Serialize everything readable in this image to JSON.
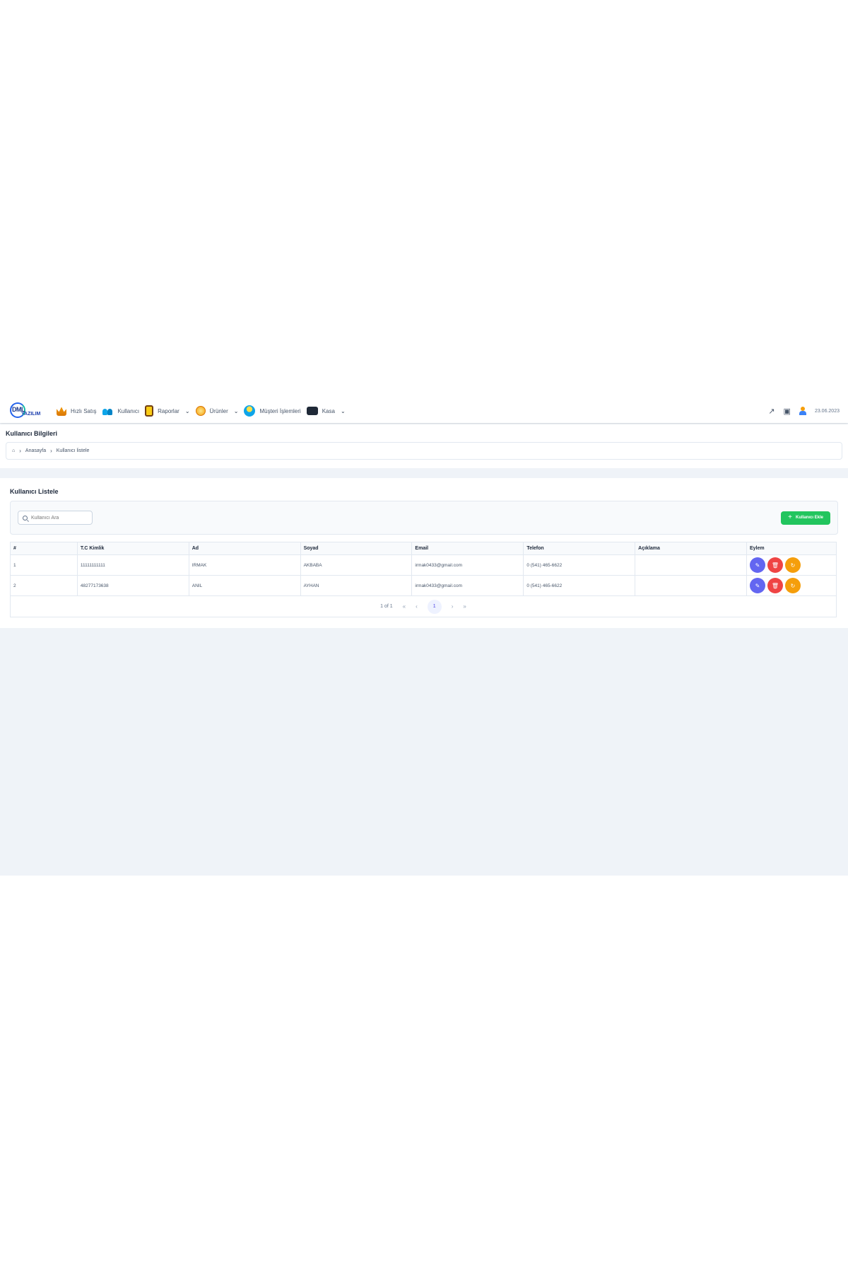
{
  "app": {
    "logo_text": "DML",
    "logo_sub": "YAZILIM"
  },
  "nav": [
    {
      "icon": "crown-icon",
      "label": "Hızlı Satış",
      "has_menu": false
    },
    {
      "icon": "users-icon",
      "label": "Kullanıcı",
      "has_menu": false
    },
    {
      "icon": "report-icon",
      "label": "Raporlar",
      "has_menu": true
    },
    {
      "icon": "coin-icon",
      "label": "Ürünler",
      "has_menu": true
    },
    {
      "icon": "customer-icon",
      "label": "Müşteri İşlemleri",
      "has_menu": false
    },
    {
      "icon": "cash-register-icon",
      "label": "Kasa",
      "has_menu": true
    }
  ],
  "header": {
    "date": "23.06.2023"
  },
  "info": {
    "title": "Kullanıcı Bilgileri",
    "breadcrumb": [
      "Anasayfa",
      "Kullanıcı listele"
    ]
  },
  "list": {
    "title": "Kullanıcı Listele",
    "search_placeholder": "Kullanıcı Ara",
    "add_button": "Kullanıcı Ekle",
    "columns": [
      "#",
      "T.C Kimlik",
      "Ad",
      "Soyad",
      "Email",
      "Telefon",
      "Açıklama",
      "Eylem"
    ],
    "rows": [
      {
        "no": "1",
        "tc": "11111111111",
        "ad": "IRMAK",
        "soyad": "AKBABA",
        "email": "irmak0433@gmail.com",
        "telefon": "0 (541) 465-6622",
        "aciklama": ""
      },
      {
        "no": "2",
        "tc": "48277173638",
        "ad": "ANIL",
        "soyad": "AYHAN",
        "email": "irmak0433@gmail.com",
        "telefon": "0 (541) 465-6622",
        "aciklama": ""
      }
    ],
    "pagination": {
      "summary": "1 of 1",
      "current": "1"
    }
  },
  "colors": {
    "accent": "#6366f1",
    "success": "#22c55e",
    "danger": "#ef4444",
    "warning": "#f59e0b",
    "background": "#eff3f8"
  }
}
